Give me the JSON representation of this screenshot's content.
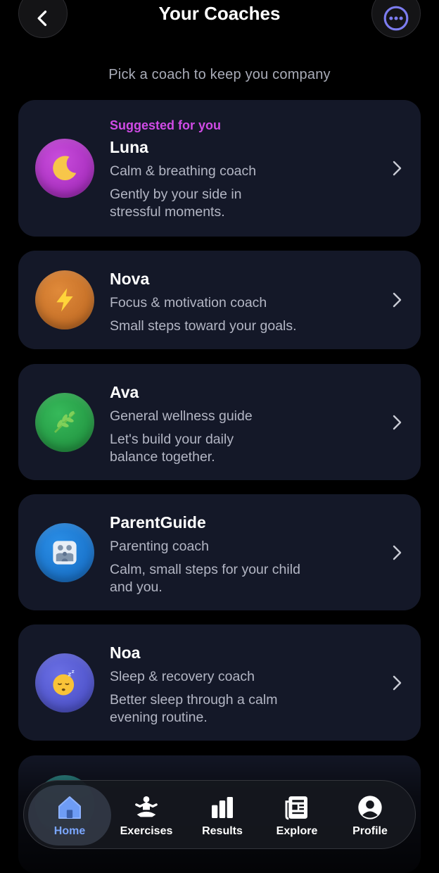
{
  "header": {
    "title": "Your Coaches"
  },
  "subtitle": "Pick a coach to keep you company",
  "coaches": [
    {
      "suggested": "Suggested for you",
      "name": "Luna",
      "role": "Calm & breathing coach",
      "desc1": "Gently by your side in",
      "desc2": "stressful moments.",
      "icon": "moon-icon",
      "color": "#b02fc4"
    },
    {
      "name": "Nova",
      "role": "Focus & motivation coach",
      "desc1": "Small steps toward your goals.",
      "icon": "lightning-icon",
      "color": "#d2782a"
    },
    {
      "name": "Ava",
      "role": "General wellness guide",
      "desc1": "Let's build your daily",
      "desc2": "balance together.",
      "icon": "leaf-icon",
      "color": "#2aa84a"
    },
    {
      "name": "ParentGuide",
      "role": "Parenting coach",
      "desc1": "Calm, small steps for your child",
      "desc2": "and you.",
      "icon": "family-icon",
      "color": "#1f7fd6"
    },
    {
      "name": "Noa",
      "role": "Sleep & recovery coach",
      "desc1": "Better sleep through a calm",
      "desc2": "evening routine.",
      "icon": "sleeping-face-icon",
      "color": "#5a5fd8"
    }
  ],
  "nav": {
    "home": "Home",
    "exercises": "Exercises",
    "results": "Results",
    "explore": "Explore",
    "profile": "Profile"
  }
}
